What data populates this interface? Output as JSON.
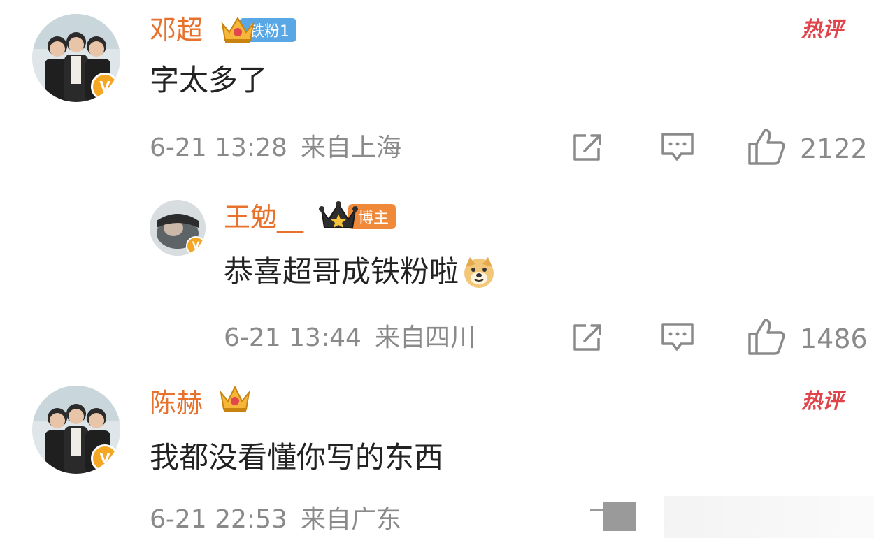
{
  "comments": [
    {
      "author": "邓超",
      "badge_label": "铁粉1",
      "text": "字太多了",
      "time": "6-21 13:28",
      "location": "来自上海",
      "likes": "2122",
      "hot_label": "热评"
    },
    {
      "author": "王勉__",
      "badge_label": "博主",
      "text": "恭喜超哥成铁粉啦",
      "time": "6-21 13:44",
      "location": "来自四川",
      "likes": "1486"
    },
    {
      "author": "陈赫",
      "text": "我都没看懂你写的东西",
      "time": "6-21 22:53",
      "location": "来自广东",
      "hot_label": "热评"
    }
  ],
  "icons": {
    "share": "share-icon",
    "comment": "comment-icon",
    "like": "thumbs-up-icon",
    "verified": "verified-v-badge-icon",
    "crown": "crown-icon",
    "doge": "doge-emoji-icon"
  },
  "colors": {
    "name": "#e8712b",
    "hot": "#e0444b",
    "meta": "#8a8a8a",
    "fan_badge": "#5aa7e6",
    "blogger_badge": "#f08a3a",
    "verified": "#f5a623"
  }
}
